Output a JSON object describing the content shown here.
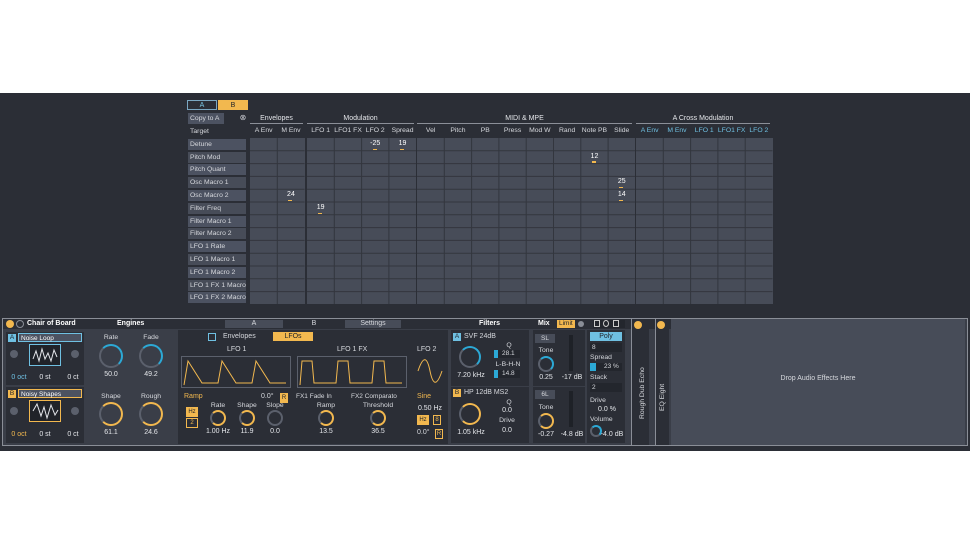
{
  "matrix": {
    "ab_tabs": [
      "A",
      "B"
    ],
    "copy_label": "Copy to A",
    "close_symbol": "⊗",
    "groups": [
      "Envelopes",
      "Modulation",
      "MIDI & MPE",
      "A Cross Modulation"
    ],
    "columns": [
      "A Env",
      "M Env",
      "LFO 1",
      "LFO1 FX",
      "LFO 2",
      "Spread",
      "Vel",
      "Pitch",
      "PB",
      "Press",
      "Mod W",
      "Rand",
      "Note PB",
      "Slide",
      "A Env",
      "M Env",
      "LFO 1",
      "LFO1 FX",
      "LFO 2"
    ],
    "rows": [
      "Target",
      "Detune",
      "Pitch Mod",
      "Pitch Quant",
      "Osc Macro 1",
      "Osc Macro 2",
      "Filter Freq",
      "Filter Macro 1",
      "Filter Macro 2",
      "LFO 1 Rate",
      "LFO 1 Macro 1",
      "LFO 1 Macro 2",
      "LFO 1 FX 1 Macro",
      "LFO 1 FX 2 Macro"
    ],
    "values": [
      {
        "row": 1,
        "col": 4,
        "value": "-25"
      },
      {
        "row": 1,
        "col": 5,
        "value": "19"
      },
      {
        "row": 2,
        "col": 12,
        "value": "12"
      },
      {
        "row": 4,
        "col": 13,
        "value": "25"
      },
      {
        "row": 5,
        "col": 1,
        "value": "24"
      },
      {
        "row": 5,
        "col": 13,
        "value": "14"
      },
      {
        "row": 6,
        "col": 2,
        "value": "19"
      }
    ]
  },
  "device": {
    "title": "Chair of Board",
    "engines_label": "Engines",
    "tab_a": "A",
    "tab_b": "B",
    "settings_label": "Settings",
    "filters_label": "Filters",
    "mix_label": "Mix",
    "limit_label": "Limit",
    "osc_a": {
      "letter": "A",
      "name": "Noise Loop",
      "oct": "0 oct",
      "st": "0 st",
      "ct": "0 ct"
    },
    "osc_b": {
      "letter": "B",
      "name": "Noisy Shapes",
      "oct": "0 oct",
      "st": "0 st",
      "ct": "0 ct"
    },
    "engine_knobs": [
      {
        "label": "Rate",
        "value": "50.0"
      },
      {
        "label": "Fade",
        "value": "49.2"
      },
      {
        "label": "Shape",
        "value": "61.1"
      },
      {
        "label": "Rough",
        "value": "24.6"
      }
    ],
    "mod_tabs": [
      "Envelopes",
      "LFOs"
    ],
    "lfo1": {
      "title": "LFO 1",
      "wave": "Ramp",
      "phase": "0.0°",
      "r_label": "R",
      "hz": "Hz",
      "num": "2",
      "rate_label": "Rate",
      "rate": "1.00 Hz",
      "shape_label": "Shape",
      "shape": "11.9",
      "slope_label": "Slope",
      "slope": "0.0"
    },
    "lfo1fx": {
      "title": "LFO 1 FX",
      "fx1": "FX1 Fade In",
      "fx2": "FX2 Comparato",
      "ramp_label": "Ramp",
      "ramp": "13.5",
      "threshold_label": "Threshold",
      "threshold": "36.5"
    },
    "lfo2": {
      "title": "LFO 2",
      "wave": "Sine",
      "rate": "0.50 Hz",
      "hz": "Hz",
      "num": "8",
      "phase": "0.0°",
      "r_label": "R"
    },
    "filter_a": {
      "letter": "A",
      "type": "SVF 24dB",
      "freq": "7.20 kHz",
      "q_label": "Q",
      "q": "28.1",
      "mode": "L-B-H-N",
      "mode_val": "14.8"
    },
    "filter_b": {
      "letter": "B",
      "type": "HP 12dB MS2",
      "freq": "1.05 kHz",
      "q_label": "Q",
      "q": "0.0",
      "drive_label": "Drive",
      "drive": "0.0"
    },
    "mix_a": {
      "btn": "SL",
      "tone_label": "Tone",
      "tone": "0.25",
      "db": "-17 dB"
    },
    "mix_b": {
      "btn": "6L",
      "tone_label": "Tone",
      "tone": "-0.27",
      "db": "-4.8 dB"
    },
    "voice": {
      "poly": "Poly",
      "voices": "8",
      "spread_label": "Spread",
      "spread": "23 %",
      "stack_label": "Stack",
      "stack": "2",
      "drive_label": "Drive",
      "drive": "0.0 %",
      "volume_label": "Volume",
      "volume": "-4.0 dB"
    },
    "fx_names": [
      "Rough Dub Echo",
      "EQ Eight"
    ],
    "drop_text": "Drop Audio Effects Here"
  }
}
